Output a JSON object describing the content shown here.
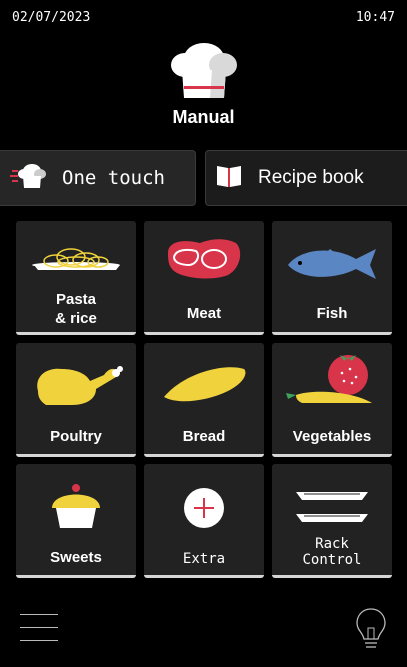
{
  "status": {
    "date": "02/07/2023",
    "time": "10:47"
  },
  "mode": {
    "label": "Manual",
    "icon": "chef-hat-icon"
  },
  "tabs": [
    {
      "label": "One touch",
      "icon": "chef-hat-icon"
    },
    {
      "label": "Recipe book",
      "icon": "open-book-icon"
    }
  ],
  "categories": [
    {
      "label_line1": "Pasta",
      "label_line2": "& rice",
      "icon": "pasta-icon"
    },
    {
      "label": "Meat",
      "icon": "steak-icon"
    },
    {
      "label": "Fish",
      "icon": "fish-icon"
    },
    {
      "label": "Poultry",
      "icon": "roast-chicken-icon"
    },
    {
      "label": "Bread",
      "icon": "baguette-icon"
    },
    {
      "label": "Vegetables",
      "icon": "tomato-carrot-icon"
    },
    {
      "label": "Sweets",
      "icon": "cupcake-icon"
    },
    {
      "label": "Extra",
      "icon": "plus-icon"
    },
    {
      "label_line1": "Rack",
      "label_line2": "Control",
      "icon": "rack-icon"
    }
  ],
  "bottom": {
    "menu_icon": "hamburger-menu-icon",
    "light_icon": "lightbulb-icon"
  },
  "colors": {
    "background": "#000000",
    "tile": "#222222",
    "accent_red": "#d8344a",
    "fish_blue": "#5b86c4",
    "yellow": "#f0d23c"
  }
}
